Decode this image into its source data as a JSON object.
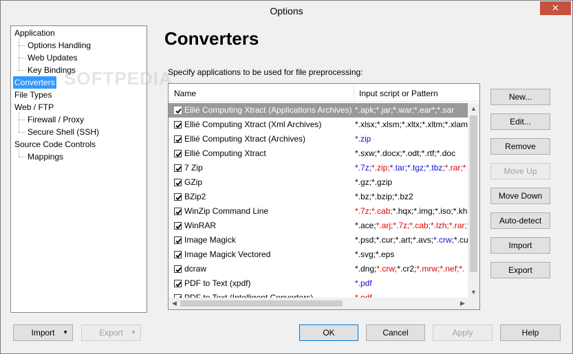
{
  "window": {
    "title": "Options",
    "close_glyph": "✕"
  },
  "tree": {
    "items": [
      {
        "label": "Application",
        "level": 0
      },
      {
        "label": "Options Handling",
        "level": 1
      },
      {
        "label": "Web Updates",
        "level": 1
      },
      {
        "label": "Key Bindings",
        "level": 1
      },
      {
        "label": "Converters",
        "level": 0,
        "selected": true
      },
      {
        "label": "File Types",
        "level": 0
      },
      {
        "label": "Web / FTP",
        "level": 0
      },
      {
        "label": "Firewall / Proxy",
        "level": 1
      },
      {
        "label": "Secure Shell (SSH)",
        "level": 1
      },
      {
        "label": "Source Code Controls",
        "level": 0
      },
      {
        "label": "Mappings",
        "level": 1
      }
    ]
  },
  "watermark": "SOFTPEDIA",
  "main": {
    "heading": "Converters",
    "subtitle": "Specify applications to be used for file preprocessing:",
    "columns": {
      "name": "Name",
      "pattern": "Input script or Pattern"
    },
    "rows": [
      {
        "name": "Ellié Computing Xtract (Applications Archives)",
        "pattern": [
          {
            "t": "*.apk;*.jar;*.war;*.ear*;*.sar",
            "c": ""
          }
        ],
        "selected": true
      },
      {
        "name": "Ellié Computing Xtract (Xml Archives)",
        "pattern": [
          {
            "t": "*.xlsx;*.xlsm;*.xltx;*.xltm;*.xlam;",
            "c": ""
          }
        ]
      },
      {
        "name": "Ellié Computing Xtract (Archives)",
        "pattern": [
          {
            "t": "*.zip",
            "c": "blue"
          }
        ]
      },
      {
        "name": "Ellié Computing Xtract",
        "pattern": [
          {
            "t": "*.sxw;*.docx;*.odt;*.rtf;*.doc",
            "c": ""
          }
        ]
      },
      {
        "name": "7 Zip",
        "pattern": [
          {
            "t": "*.7z;",
            "c": "blue"
          },
          {
            "t": "*.zip;",
            "c": "red"
          },
          {
            "t": "*.tar;*.tgz;*.tbz;",
            "c": "blue"
          },
          {
            "t": "*.rar;*",
            "c": "red"
          }
        ]
      },
      {
        "name": "GZip",
        "pattern": [
          {
            "t": "*.gz;*.gzip",
            "c": ""
          }
        ]
      },
      {
        "name": "BZip2",
        "pattern": [
          {
            "t": "*.bz;*.bzip;*.bz2",
            "c": ""
          }
        ]
      },
      {
        "name": "WinZip Command Line",
        "pattern": [
          {
            "t": "*.7z;*.cab;",
            "c": "red"
          },
          {
            "t": "*.hqx;*.img;*.iso;*.kh",
            "c": ""
          }
        ]
      },
      {
        "name": "WinRAR",
        "pattern": [
          {
            "t": "*.ace;",
            "c": ""
          },
          {
            "t": "*.arj;*.7z;*.cab;*.lzh;*.rar;*",
            "c": "red"
          }
        ]
      },
      {
        "name": "Image Magick",
        "pattern": [
          {
            "t": "*.psd;*.cur;*.art;*.avs;",
            "c": ""
          },
          {
            "t": "*.crw;",
            "c": "blue"
          },
          {
            "t": "*.cu",
            "c": ""
          }
        ]
      },
      {
        "name": "Image Magick Vectored",
        "pattern": [
          {
            "t": "*.svg;*.eps",
            "c": ""
          }
        ]
      },
      {
        "name": "dcraw",
        "pattern": [
          {
            "t": "*.dng;",
            "c": ""
          },
          {
            "t": "*.crw;",
            "c": "red"
          },
          {
            "t": "*.cr2;",
            "c": ""
          },
          {
            "t": "*.mrw;*.nef;*.",
            "c": "red"
          }
        ]
      },
      {
        "name": "PDF to Text (xpdf)",
        "pattern": [
          {
            "t": "*.pdf",
            "c": "blue"
          }
        ]
      },
      {
        "name": "PDF to Text (Intelligent Converters)",
        "pattern": [
          {
            "t": "*.pdf",
            "c": "red"
          }
        ]
      }
    ],
    "scroll": {
      "up": "▲",
      "down": "▼",
      "left": "◀",
      "right": "▶"
    }
  },
  "side_buttons": {
    "new": "New...",
    "edit": "Edit...",
    "remove": "Remove",
    "move_up": "Move Up",
    "move_down": "Move Down",
    "auto_detect": "Auto-detect",
    "import": "Import",
    "export": "Export"
  },
  "bottom_buttons": {
    "import": "Import",
    "export": "Export",
    "ok": "OK",
    "cancel": "Cancel",
    "apply": "Apply",
    "help": "Help",
    "dropdown_glyph": "▼"
  }
}
